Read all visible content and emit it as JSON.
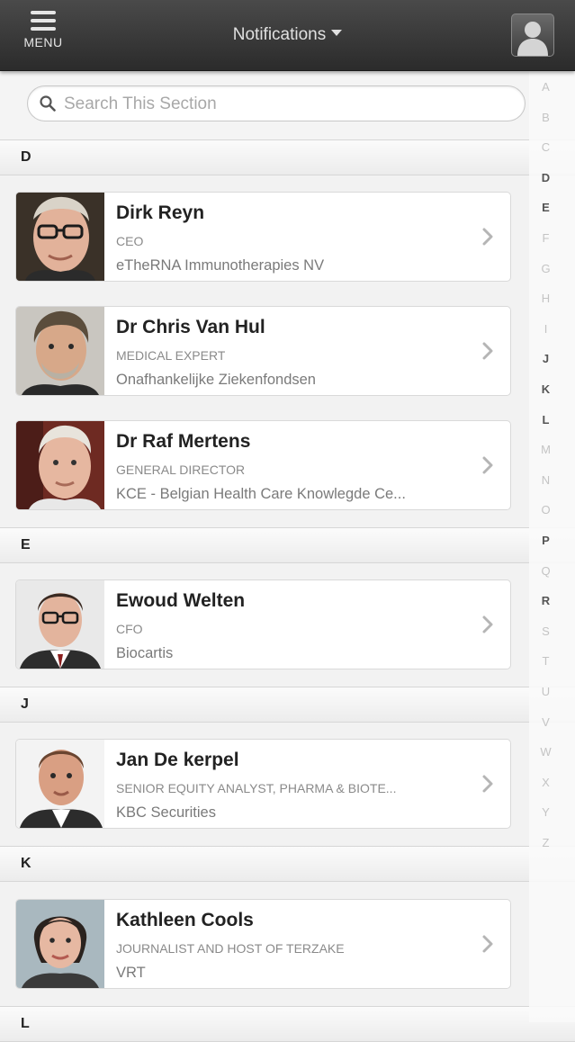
{
  "header": {
    "menu_label": "MENU",
    "title": "Notifications"
  },
  "search": {
    "placeholder": "Search This Section"
  },
  "index": [
    "A",
    "B",
    "C",
    "D",
    "E",
    "F",
    "G",
    "H",
    "I",
    "J",
    "K",
    "L",
    "M",
    "N",
    "O",
    "P",
    "Q",
    "R",
    "S",
    "T",
    "U",
    "V",
    "W",
    "X",
    "Y",
    "Z"
  ],
  "index_active": [
    "D",
    "E",
    "J",
    "K",
    "L",
    "P",
    "R"
  ],
  "sections": [
    {
      "letter": "D",
      "contacts": [
        {
          "name": "Dirk Reyn",
          "role": "CEO",
          "org": "eTheRNA Immunotherapies NV"
        },
        {
          "name": "Dr Chris Van Hul",
          "role": "MEDICAL EXPERT",
          "org": "Onafhankelijke Ziekenfondsen"
        },
        {
          "name": "Dr Raf Mertens",
          "role": "GENERAL DIRECTOR",
          "org": "KCE - Belgian Health Care Knowlegde Ce..."
        }
      ]
    },
    {
      "letter": "E",
      "contacts": [
        {
          "name": "Ewoud Welten",
          "role": "CFO",
          "org": "Biocartis"
        }
      ]
    },
    {
      "letter": "J",
      "contacts": [
        {
          "name": "Jan De kerpel",
          "role": "SENIOR EQUITY ANALYST, PHARMA & BIOTE...",
          "org": "KBC Securities"
        }
      ]
    },
    {
      "letter": "K",
      "contacts": [
        {
          "name": "Kathleen Cools",
          "role": "JOURNALIST AND HOST OF TERZAKE",
          "org": "VRT"
        }
      ]
    },
    {
      "letter": "L",
      "contacts": []
    }
  ],
  "colors": {
    "header_bg": "#333333",
    "page_bg": "#f2f2f2",
    "card_bg": "#ffffff",
    "name_text": "#222222",
    "role_text": "#8a8a8a"
  },
  "icons": {
    "menu": "hamburger-icon",
    "user": "user-silhouette-icon",
    "search": "magnifier-icon",
    "row": "chevron-right-icon"
  }
}
